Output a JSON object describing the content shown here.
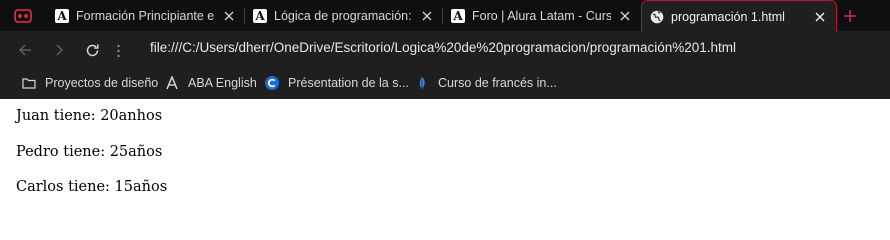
{
  "tabs": [
    {
      "label": "Formación Principiante en P",
      "favicon": "A",
      "active": false
    },
    {
      "label": "Lógica de programación: Pr",
      "favicon": "A",
      "active": false
    },
    {
      "label": "Foro | Alura Latam - Cursos",
      "favicon": "A",
      "active": false
    },
    {
      "label": "programación 1.html",
      "favicon": "globe-icon",
      "active": true
    }
  ],
  "address": {
    "url": "file:///C:/Users/dherr/OneDrive/Escritorio/Logica%20de%20programacion/programación%201.html"
  },
  "bookmarks": [
    {
      "label": "Proyectos de diseño",
      "icon": "folder-icon"
    },
    {
      "label": "ABA English",
      "icon": "a-logo-icon"
    },
    {
      "label": "Présentation de la s...",
      "icon": "c-logo-icon"
    },
    {
      "label": "Curso de francés in...",
      "icon": "leaf-icon"
    }
  ],
  "content": {
    "lines": [
      "Juan tiene: 20anhos",
      "Pedro tiene: 25años",
      "Carlos tiene: 15años"
    ]
  },
  "colors": {
    "accent": "#b0123a",
    "tabstrip": "#0f0f0f",
    "toolbar": "#1f1f1f",
    "page": "#ffffff"
  }
}
